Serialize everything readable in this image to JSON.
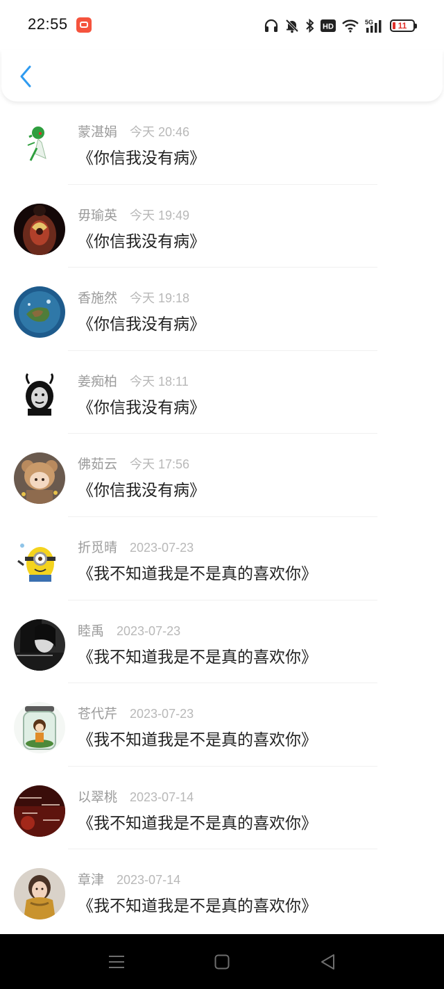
{
  "status_bar": {
    "time": "22:55",
    "battery_level": "11",
    "network": "5G",
    "hd_label": "HD",
    "icons": [
      "headphones-icon",
      "bell-muted-icon",
      "bluetooth-icon",
      "hd-icon",
      "wifi-icon",
      "signal-5g-icon",
      "battery-icon"
    ]
  },
  "header": {
    "back_icon": "chevron-left-icon",
    "accent_color": "#2f9bf0"
  },
  "messages": [
    {
      "name": "蒙湛娟",
      "time": "今天 20:46",
      "text": "《你信我没有病》",
      "avatar": "green-creature-avatar"
    },
    {
      "name": "毋瑜英",
      "time": "今天 19:49",
      "text": "《你信我没有病》",
      "avatar": "tattoo-back-avatar"
    },
    {
      "name": "香施然",
      "time": "今天 19:18",
      "text": "《你信我没有病》",
      "avatar": "planet-island-avatar"
    },
    {
      "name": "姜痴柏",
      "time": "今天 18:11",
      "text": "《你信我没有病》",
      "avatar": "meme-face-avatar"
    },
    {
      "name": "佛茹云",
      "time": "今天 17:56",
      "text": "《你信我没有病》",
      "avatar": "anime-bear-girl-avatar"
    },
    {
      "name": "折觅晴",
      "time": "2023-07-23",
      "text": "《我不知道我是不是真的喜欢你》",
      "avatar": "minion-avatar"
    },
    {
      "name": "睦禹",
      "time": "2023-07-23",
      "text": "《我不知道我是不是真的喜欢你》",
      "avatar": "dark-portrait-avatar"
    },
    {
      "name": "苍代芹",
      "time": "2023-07-23",
      "text": "《我不知道我是不是真的喜欢你》",
      "avatar": "jar-girl-avatar"
    },
    {
      "name": "以翠桃",
      "time": "2023-07-14",
      "text": "《我不知道我是不是真的喜欢你》",
      "avatar": "sunset-text-avatar"
    },
    {
      "name": "章津",
      "time": "2023-07-14",
      "text": "《我不知道我是不是真的喜欢你》",
      "avatar": "scarf-girl-avatar"
    }
  ],
  "nav_bar": {
    "icons": [
      "menu-icon",
      "home-icon",
      "back-triangle-icon"
    ]
  }
}
